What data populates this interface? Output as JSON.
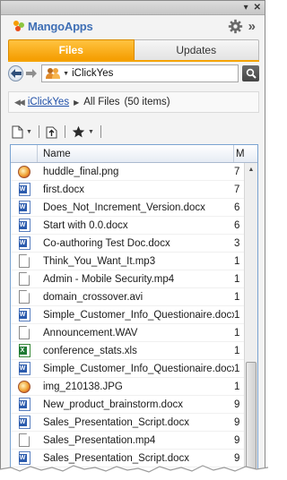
{
  "app": {
    "logo_text": "MangoApps",
    "brand_color": "#3f6fb5",
    "accent_color": "#f59d00"
  },
  "titlebar": {
    "dropdown_icon": "triangle-down-icon",
    "close_icon": "close-icon"
  },
  "header": {
    "settings_icon": "gear-icon",
    "expand_icon": "double-chevron-right-icon"
  },
  "tabs": [
    {
      "label": "Files",
      "active": true
    },
    {
      "label": "Updates",
      "active": false
    }
  ],
  "nav": {
    "location": "iClickYes",
    "location_icon": "users-icon",
    "search_icon": "search-icon"
  },
  "breadcrumb": {
    "root_link": "iClickYes",
    "current": "All Files",
    "count": "(50 items)"
  },
  "toolbar": {
    "new_icon": "new-document-icon",
    "upload_icon": "upload-icon",
    "favorites_icon": "star-icon"
  },
  "table": {
    "columns": [
      "Name",
      "M"
    ],
    "rows": [
      {
        "icon": "image",
        "name": "huddle_final.png",
        "mod": "7"
      },
      {
        "icon": "word",
        "name": "first.docx",
        "mod": "7"
      },
      {
        "icon": "word",
        "name": "Does_Not_Increment_Version.docx",
        "mod": "6"
      },
      {
        "icon": "word",
        "name": "Start with 0.0.docx",
        "mod": "6"
      },
      {
        "icon": "word",
        "name": "Co-authoring Test Doc.docx",
        "mod": "3"
      },
      {
        "icon": "blank",
        "name": "Think_You_Want_It.mp3",
        "mod": "1"
      },
      {
        "icon": "blank",
        "name": "Admin - Mobile Security.mp4",
        "mod": "1"
      },
      {
        "icon": "blank",
        "name": "domain_crossover.avi",
        "mod": "1"
      },
      {
        "icon": "word",
        "name": "Simple_Customer_Info_Questionaire.docx",
        "mod": "1"
      },
      {
        "icon": "blank",
        "name": "Announcement.WAV",
        "mod": "1"
      },
      {
        "icon": "excel",
        "name": "conference_stats.xls",
        "mod": "1"
      },
      {
        "icon": "word",
        "name": "Simple_Customer_Info_Questionaire.docx",
        "mod": "1"
      },
      {
        "icon": "image",
        "name": "img_210138.JPG",
        "mod": "1"
      },
      {
        "icon": "word",
        "name": "New_product_brainstorm.docx",
        "mod": "9"
      },
      {
        "icon": "word",
        "name": "Sales_Presentation_Script.docx",
        "mod": "9"
      },
      {
        "icon": "blank",
        "name": "Sales_Presentation.mp4",
        "mod": "9"
      },
      {
        "icon": "word",
        "name": "Sales_Presentation_Script.docx",
        "mod": "9"
      }
    ]
  }
}
